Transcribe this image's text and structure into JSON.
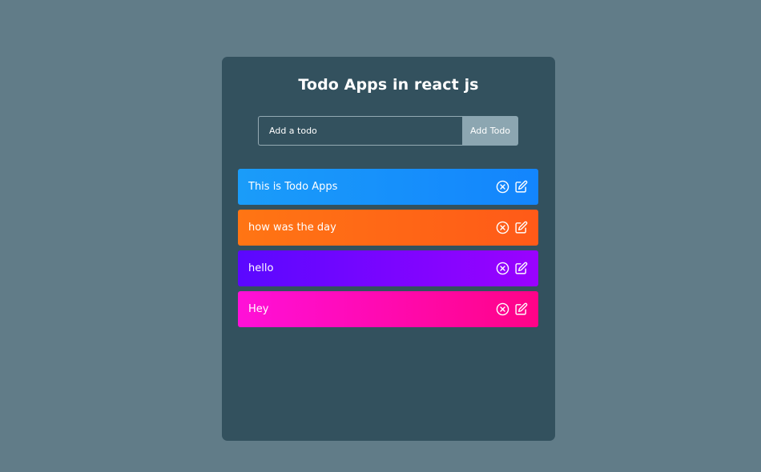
{
  "app": {
    "title": "Todo Apps in react js"
  },
  "form": {
    "input_placeholder": "Add a todo",
    "input_value": "",
    "add_button_label": "Add Todo"
  },
  "todos": [
    {
      "text": "This is Todo Apps",
      "color_start": "#1a9cf9",
      "color_end": "#1385fd"
    },
    {
      "text": "how was the day",
      "color_start": "#ff7514",
      "color_end": "#ff5a18"
    },
    {
      "text": "hello",
      "color_start": "#5a08ff",
      "color_end": "#9a02ff"
    },
    {
      "text": "Hey",
      "color_start": "#ff10d8",
      "color_end": "#ff0387"
    }
  ],
  "icons": {
    "delete": "close-circle-icon",
    "edit": "edit-icon"
  },
  "colors": {
    "page_background": "#617c88",
    "card_background": "#33515e",
    "button_background": "#8ca6b1"
  }
}
